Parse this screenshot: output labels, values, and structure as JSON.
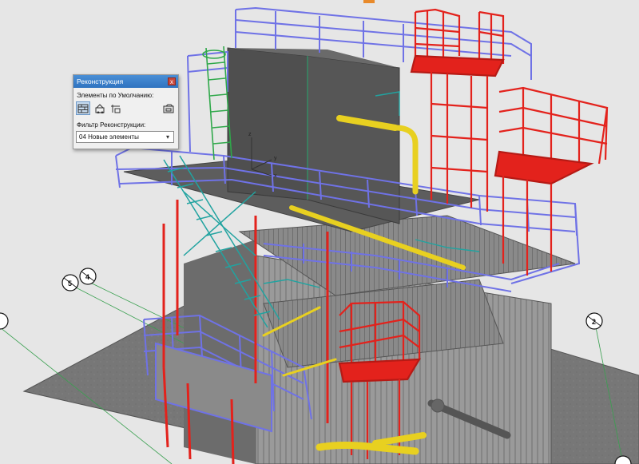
{
  "palette": {
    "title": "Реконструкция",
    "close_glyph": "x",
    "section_label": "Элементы по Умолчанию:",
    "icons": [
      "existing-elements-icon",
      "demolished-elements-icon",
      "new-elements-icon",
      "override-settings-icon"
    ],
    "filter_label": "Фильтр Реконструкции:",
    "filter_value": "04 Новые элементы"
  },
  "axes": {
    "x": "x",
    "y": "y",
    "z": "z"
  },
  "grid_bubbles": [
    "5",
    "4",
    "2"
  ],
  "colors": {
    "railing_blue": "#6f72e6",
    "new_red": "#e3221c",
    "ladder_green": "#2fa84a",
    "stair_teal": "#21a3a0",
    "pipe_yellow": "#e8d020",
    "concrete_grey": "#7a7a7a",
    "panel_dark": "#4e4e4e",
    "accent_blue": "#2f73c0"
  }
}
